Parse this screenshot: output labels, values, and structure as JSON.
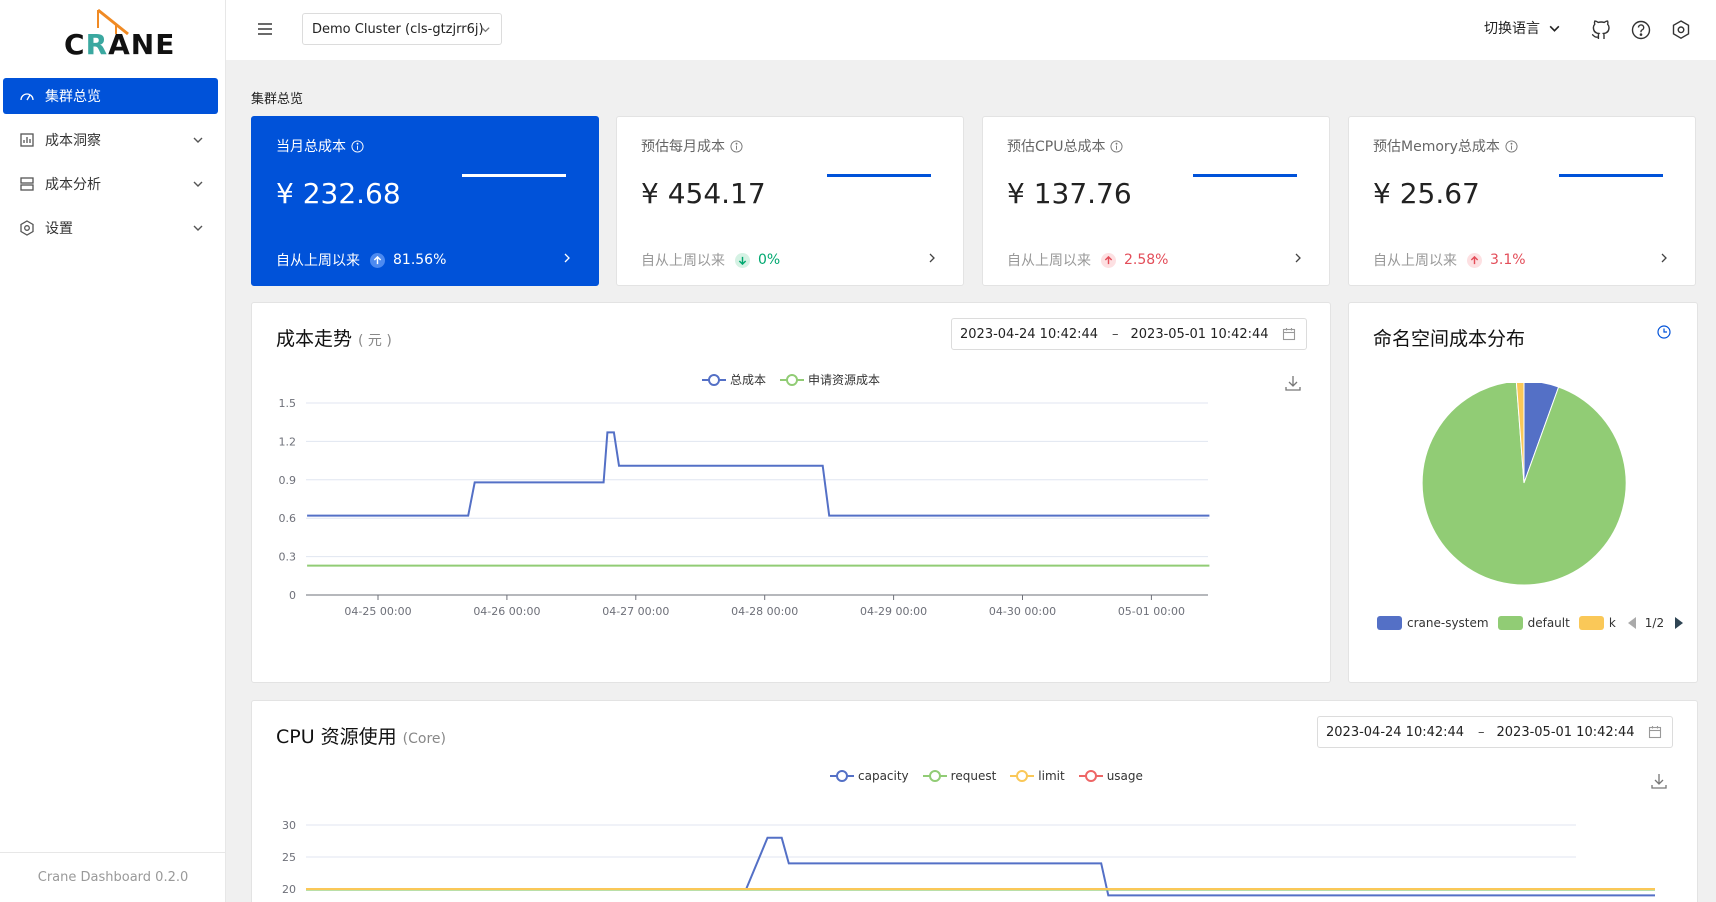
{
  "app": {
    "logo_text_pre": "C",
    "logo_text_r": "R",
    "logo_text_post": "ANE",
    "version": "Crane Dashboard 0.2.0"
  },
  "sidebar": {
    "items": [
      {
        "label": "集群总览",
        "icon": "dashboard-icon",
        "active": true
      },
      {
        "label": "成本洞察",
        "icon": "chart-bar-icon",
        "expandable": true
      },
      {
        "label": "成本分析",
        "icon": "server-icon",
        "expandable": true
      },
      {
        "label": "设置",
        "icon": "settings-icon",
        "expandable": true
      }
    ]
  },
  "header": {
    "cluster_select": "Demo Cluster (cls-gtzjrr6j)",
    "language": "切换语言",
    "icons": [
      "menu-icon",
      "github-icon",
      "help-icon",
      "settings-icon"
    ]
  },
  "overview": {
    "title": "集群总览",
    "stats": [
      {
        "label": "当月总成本",
        "value": "¥ 232.68",
        "trend_label": "自从上周以来",
        "trend": "81.56%",
        "direction": "up"
      },
      {
        "label": "预估每月成本",
        "value": "¥ 454.17",
        "trend_label": "自从上周以来",
        "trend": "0%",
        "direction": "down"
      },
      {
        "label": "预估CPU总成本",
        "value": "¥ 137.76",
        "trend_label": "自从上周以来",
        "trend": "2.58%",
        "direction": "up"
      },
      {
        "label": "预估Memory总成本",
        "value": "¥ 25.67",
        "trend_label": "自从上周以来",
        "trend": "3.1%",
        "direction": "up"
      }
    ]
  },
  "cost_trend": {
    "title": "成本走势",
    "unit": "( 元 )",
    "date_start": "2023-04-24 10:42:44",
    "date_sep": "–",
    "date_end": "2023-05-01 10:42:44"
  },
  "namespace_cost": {
    "title": "命名空间成本分布",
    "legend_page": "1/2"
  },
  "cpu_usage": {
    "title": "CPU 资源使用",
    "unit": "(Core)",
    "date_start": "2023-04-24 10:42:44",
    "date_sep": "–",
    "date_end": "2023-05-01 10:42:44"
  },
  "colors": {
    "primary": "#0052d9",
    "blue": "#5470c6",
    "green": "#91cc75",
    "yellow": "#fac858",
    "red": "#ee6666",
    "up": "#e34d59",
    "down": "#00a870"
  },
  "chart_data": [
    {
      "type": "line",
      "x": [
        "04-25 00:00",
        "04-26 00:00",
        "04-27 00:00",
        "04-28 00:00",
        "04-29 00:00",
        "04-30 00:00",
        "05-01 00:00"
      ],
      "ylim": [
        0,
        1.5
      ],
      "yticks": [
        "0",
        "0.3",
        "0.6",
        "0.9",
        "1.2",
        "1.5"
      ],
      "grid": true,
      "legend": "top-center",
      "series": [
        {
          "name": "总成本",
          "color": "#5470c6",
          "points": [
            [
              -0.55,
              0.62
            ],
            [
              0.7,
              0.62
            ],
            [
              0.75,
              0.88
            ],
            [
              1.75,
              0.88
            ],
            [
              1.78,
              1.27
            ],
            [
              1.83,
              1.27
            ],
            [
              1.87,
              1.01
            ],
            [
              3.45,
              1.01
            ],
            [
              3.5,
              0.62
            ],
            [
              6.45,
              0.62
            ]
          ]
        },
        {
          "name": "申请资源成本",
          "color": "#91cc75",
          "points": [
            [
              -0.55,
              0.23
            ],
            [
              6.45,
              0.23
            ]
          ]
        }
      ]
    },
    {
      "type": "pie",
      "slices": [
        {
          "name": "crane-system",
          "value": 5.5,
          "color": "#5470c6"
        },
        {
          "name": "default",
          "value": 93.3,
          "color": "#91cc75"
        },
        {
          "name": "k",
          "value": 1.2,
          "color": "#fac858"
        }
      ]
    },
    {
      "type": "line",
      "x": [],
      "ylim": [
        20,
        30
      ],
      "yticks": [
        "20",
        "25",
        "30"
      ],
      "grid": true,
      "legend": "top-center",
      "series": [
        {
          "name": "capacity",
          "color": "#5470c6",
          "points": [
            [
              0,
              20
            ],
            [
              1.7,
              20
            ],
            [
              1.75,
              20.0
            ],
            [
              3.1,
              20
            ],
            [
              3.25,
              28
            ],
            [
              3.35,
              28
            ],
            [
              3.4,
              24
            ],
            [
              5.6,
              24
            ],
            [
              5.65,
              19
            ],
            [
              9.5,
              19
            ]
          ]
        },
        {
          "name": "request",
          "color": "#91cc75",
          "points": [
            [
              0,
              19.9
            ],
            [
              9.5,
              19.9
            ]
          ]
        },
        {
          "name": "limit",
          "color": "#fac858",
          "points": [
            [
              0,
              20.0
            ],
            [
              9.5,
              20.0
            ]
          ]
        },
        {
          "name": "usage",
          "color": "#ee6666",
          "points": []
        }
      ]
    }
  ]
}
